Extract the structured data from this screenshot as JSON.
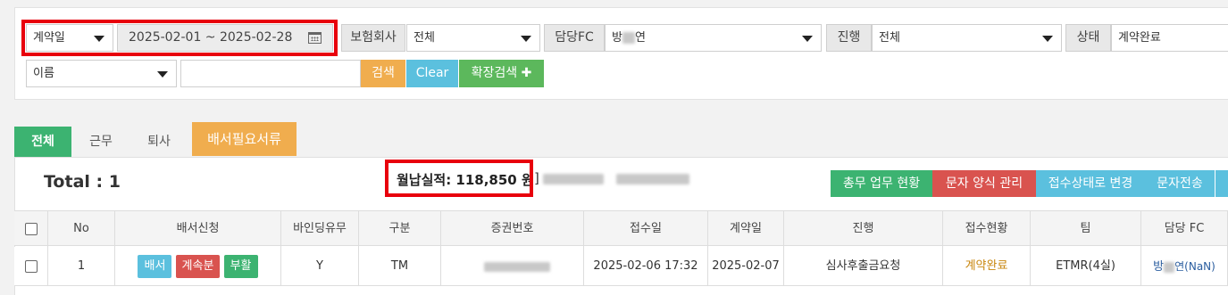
{
  "filters": {
    "date_type": "계약일",
    "date_range": "2025-02-01 ~ 2025-02-28",
    "insurer_label": "보험회사",
    "insurer_value": "전체",
    "fc_label": "담당FC",
    "fc_value_left": "방",
    "fc_value_right": "연",
    "progress_label": "진행",
    "progress_value": "전체",
    "status_label": "상태",
    "status_value": "계약완료",
    "name_select": "이름",
    "search_value": "",
    "search_button": "검색",
    "clear_button": "Clear",
    "expand_button": "확장검색",
    "expand_icon": "✚"
  },
  "tabs": [
    "전체",
    "근무",
    "퇴사"
  ],
  "required_docs_button": "배서필요서류",
  "summary": {
    "total": "Total : 1",
    "monthly": "월납실적: 118,850 원",
    "bracket": "]"
  },
  "actions": [
    "총무 업무 현황",
    "문자 양식 관리",
    "접수상태로 변경",
    "문자전송"
  ],
  "table": {
    "headers": [
      "No",
      "배서신청",
      "바인딩유무",
      "구분",
      "증권번호",
      "접수일",
      "계약일",
      "진행",
      "접수현황",
      "팀",
      "담당 FC"
    ],
    "row": {
      "no": "1",
      "btn_endorse": "배서",
      "btn_continue": "계속분",
      "btn_revive": "부활",
      "binding": "Y",
      "type": "TM",
      "received": "2025-02-06 17:32",
      "contract": "2025-02-07",
      "progress": "심사후출금요청",
      "status": "계약완료",
      "team": "ETMR(4실)",
      "fc_left": "방",
      "fc_right": "연(NaN)"
    }
  },
  "colors": {
    "green": "#3cb371",
    "orange": "#f0ad4e",
    "red": "#d9534f",
    "blue": "#5bc0de",
    "status_text": "#c8860d",
    "highlight": "#e8000c"
  }
}
